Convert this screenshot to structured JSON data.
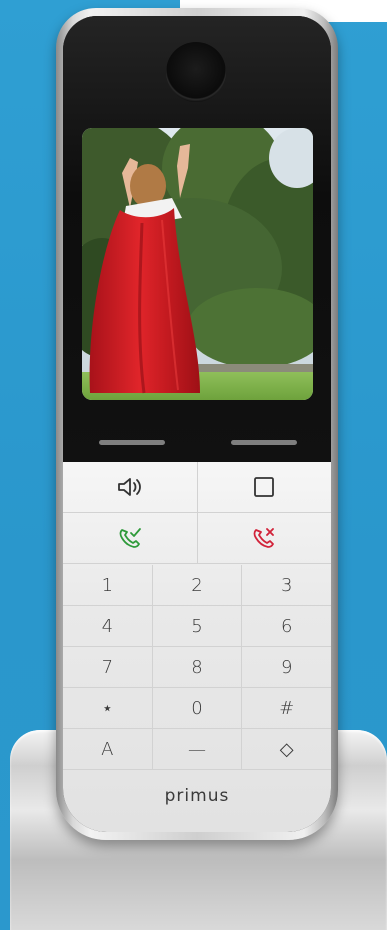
{
  "brand": "primus",
  "colors": {
    "background": "#2b98cd",
    "call_accept": "#2e9a3a",
    "call_reject": "#d2233a"
  },
  "screen_image": "child-in-red-cape-photo",
  "function_keys": [
    {
      "icon": "speaker-icon"
    },
    {
      "icon": "menu-square-icon"
    },
    {
      "icon": "call-accept-icon"
    },
    {
      "icon": "call-end-icon"
    }
  ],
  "keypad": {
    "rows": [
      [
        "1",
        "2",
        "3"
      ],
      [
        "4",
        "5",
        "6"
      ],
      [
        "7",
        "8",
        "9"
      ],
      [
        "⋆",
        "0",
        "#"
      ],
      [
        "A",
        "—",
        "◇"
      ]
    ]
  }
}
